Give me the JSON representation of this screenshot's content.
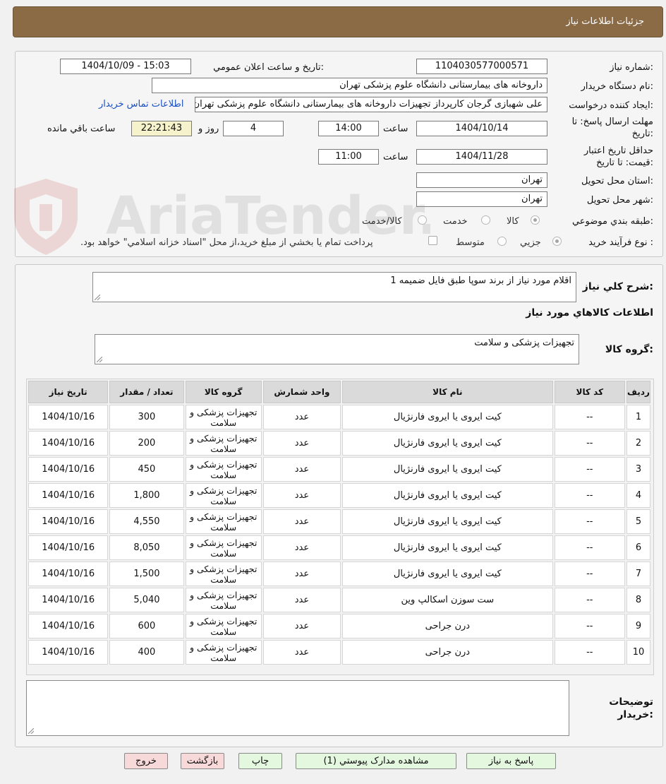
{
  "header": {
    "title": "جزئيات اطلاعات نياز"
  },
  "info": {
    "need_number_label": "شماره نياز:",
    "need_number": "1104030577000571",
    "announce_label": "تاريخ و ساعت اعلان عمومي:",
    "announce_value": "1404/10/09 - 15:03",
    "buyer_org_label": "نام دستگاه خريدار:",
    "buyer_org": "داروخانه های بیمارستانی دانشگاه علوم پزشکی تهران",
    "requester_label": "ايجاد کننده درخواست:",
    "requester": "علی شهبازی گرجان کارپرداز تجهیزات داروخانه های بیمارستانی دانشگاه علوم پزشکی تهران",
    "contact_link": "اطلاعات تماس خريدار",
    "deadline_label_1": "مهلت ارسال پاسخ: تا",
    "deadline_label_2": "تاريخ:",
    "deadline_date": "1404/10/14",
    "time_label": "ساعت",
    "deadline_time": "14:00",
    "remaining_days": "4",
    "days_and_label": "روز و",
    "remaining_time": "22:21:43",
    "remaining_label": "ساعت باقي مانده",
    "validity_label_1": "حداقل تاريخ اعتبار",
    "validity_label_2": "قيمت: تا تاريخ:",
    "validity_date": "1404/11/28",
    "validity_time": "11:00",
    "province_label": "استان محل تحويل:",
    "province": "تهران",
    "city_label": "شهر محل تحويل:",
    "city": "تهران",
    "category_label": "طبقه بندي موضوعي:",
    "category_options": [
      "کالا",
      "خدمت",
      "کالا/خدمت"
    ],
    "process_label": "نوع فرآيند خريد :",
    "process_options": [
      "جزيي",
      "متوسط"
    ],
    "payment_note": "پرداخت تمام يا بخشي از مبلغ خريد،از محل \"اسناد خزانه اسلامي\" خواهد بود."
  },
  "description": {
    "label": "شرح کلي نياز:",
    "value": "اقلام مورد نیاز از برند سوپا طبق فایل ضمیمه 1"
  },
  "goods_section_title": "اطلاعات کالاهاي مورد نياز",
  "goods_group": {
    "label": "گروه کالا:",
    "value": "تجهیزات پزشکی و سلامت"
  },
  "table": {
    "headers": [
      "رديف",
      "کد کالا",
      "نام کالا",
      "واحد شمارش",
      "گروه کالا",
      "تعداد / مقدار",
      "تاريخ نياز"
    ],
    "rows": [
      [
        "1",
        "--",
        "کیت ایروی یا ایروی فارنژیال",
        "عدد",
        "تجهيزات پزشکی و سلامت",
        "300",
        "1404/10/16"
      ],
      [
        "2",
        "--",
        "کیت ایروی یا ایروی فارنژیال",
        "عدد",
        "تجهيزات پزشکی و سلامت",
        "200",
        "1404/10/16"
      ],
      [
        "3",
        "--",
        "کیت ایروی یا ایروی فارنژیال",
        "عدد",
        "تجهيزات پزشکی و سلامت",
        "450",
        "1404/10/16"
      ],
      [
        "4",
        "--",
        "کیت ایروی یا ایروی فارنژیال",
        "عدد",
        "تجهيزات پزشکی و سلامت",
        "1,800",
        "1404/10/16"
      ],
      [
        "5",
        "--",
        "کیت ایروی یا ایروی فارنژیال",
        "عدد",
        "تجهيزات پزشکی و سلامت",
        "4,550",
        "1404/10/16"
      ],
      [
        "6",
        "--",
        "کیت ایروی یا ایروی فارنژیال",
        "عدد",
        "تجهيزات پزشکی و سلامت",
        "8,050",
        "1404/10/16"
      ],
      [
        "7",
        "--",
        "کیت ایروی یا ایروی فارنژیال",
        "عدد",
        "تجهيزات پزشکی و سلامت",
        "1,500",
        "1404/10/16"
      ],
      [
        "8",
        "--",
        "ست سوزن اسکالپ وین",
        "عدد",
        "تجهيزات پزشکی و سلامت",
        "5,040",
        "1404/10/16"
      ],
      [
        "9",
        "--",
        "درن جراحی",
        "عدد",
        "تجهيزات پزشکی و سلامت",
        "600",
        "1404/10/16"
      ],
      [
        "10",
        "--",
        "درن جراحی",
        "عدد",
        "تجهيزات پزشکی و سلامت",
        "400",
        "1404/10/16"
      ]
    ]
  },
  "buyer_notes": {
    "label_1": "توضيحات",
    "label_2": "خريدار:",
    "value": ""
  },
  "buttons": {
    "reply": "پاسخ به نياز",
    "attachments": "مشاهده مدارک پيوستي (1)",
    "print": "چاپ",
    "back": "بازگشت",
    "exit": "خروج"
  },
  "watermark": {
    "brand": "AriaTender.neT"
  },
  "colors": {
    "header": "#8a6b46",
    "link": "#1a4fc2",
    "time_bg": "#f6f2cc"
  }
}
